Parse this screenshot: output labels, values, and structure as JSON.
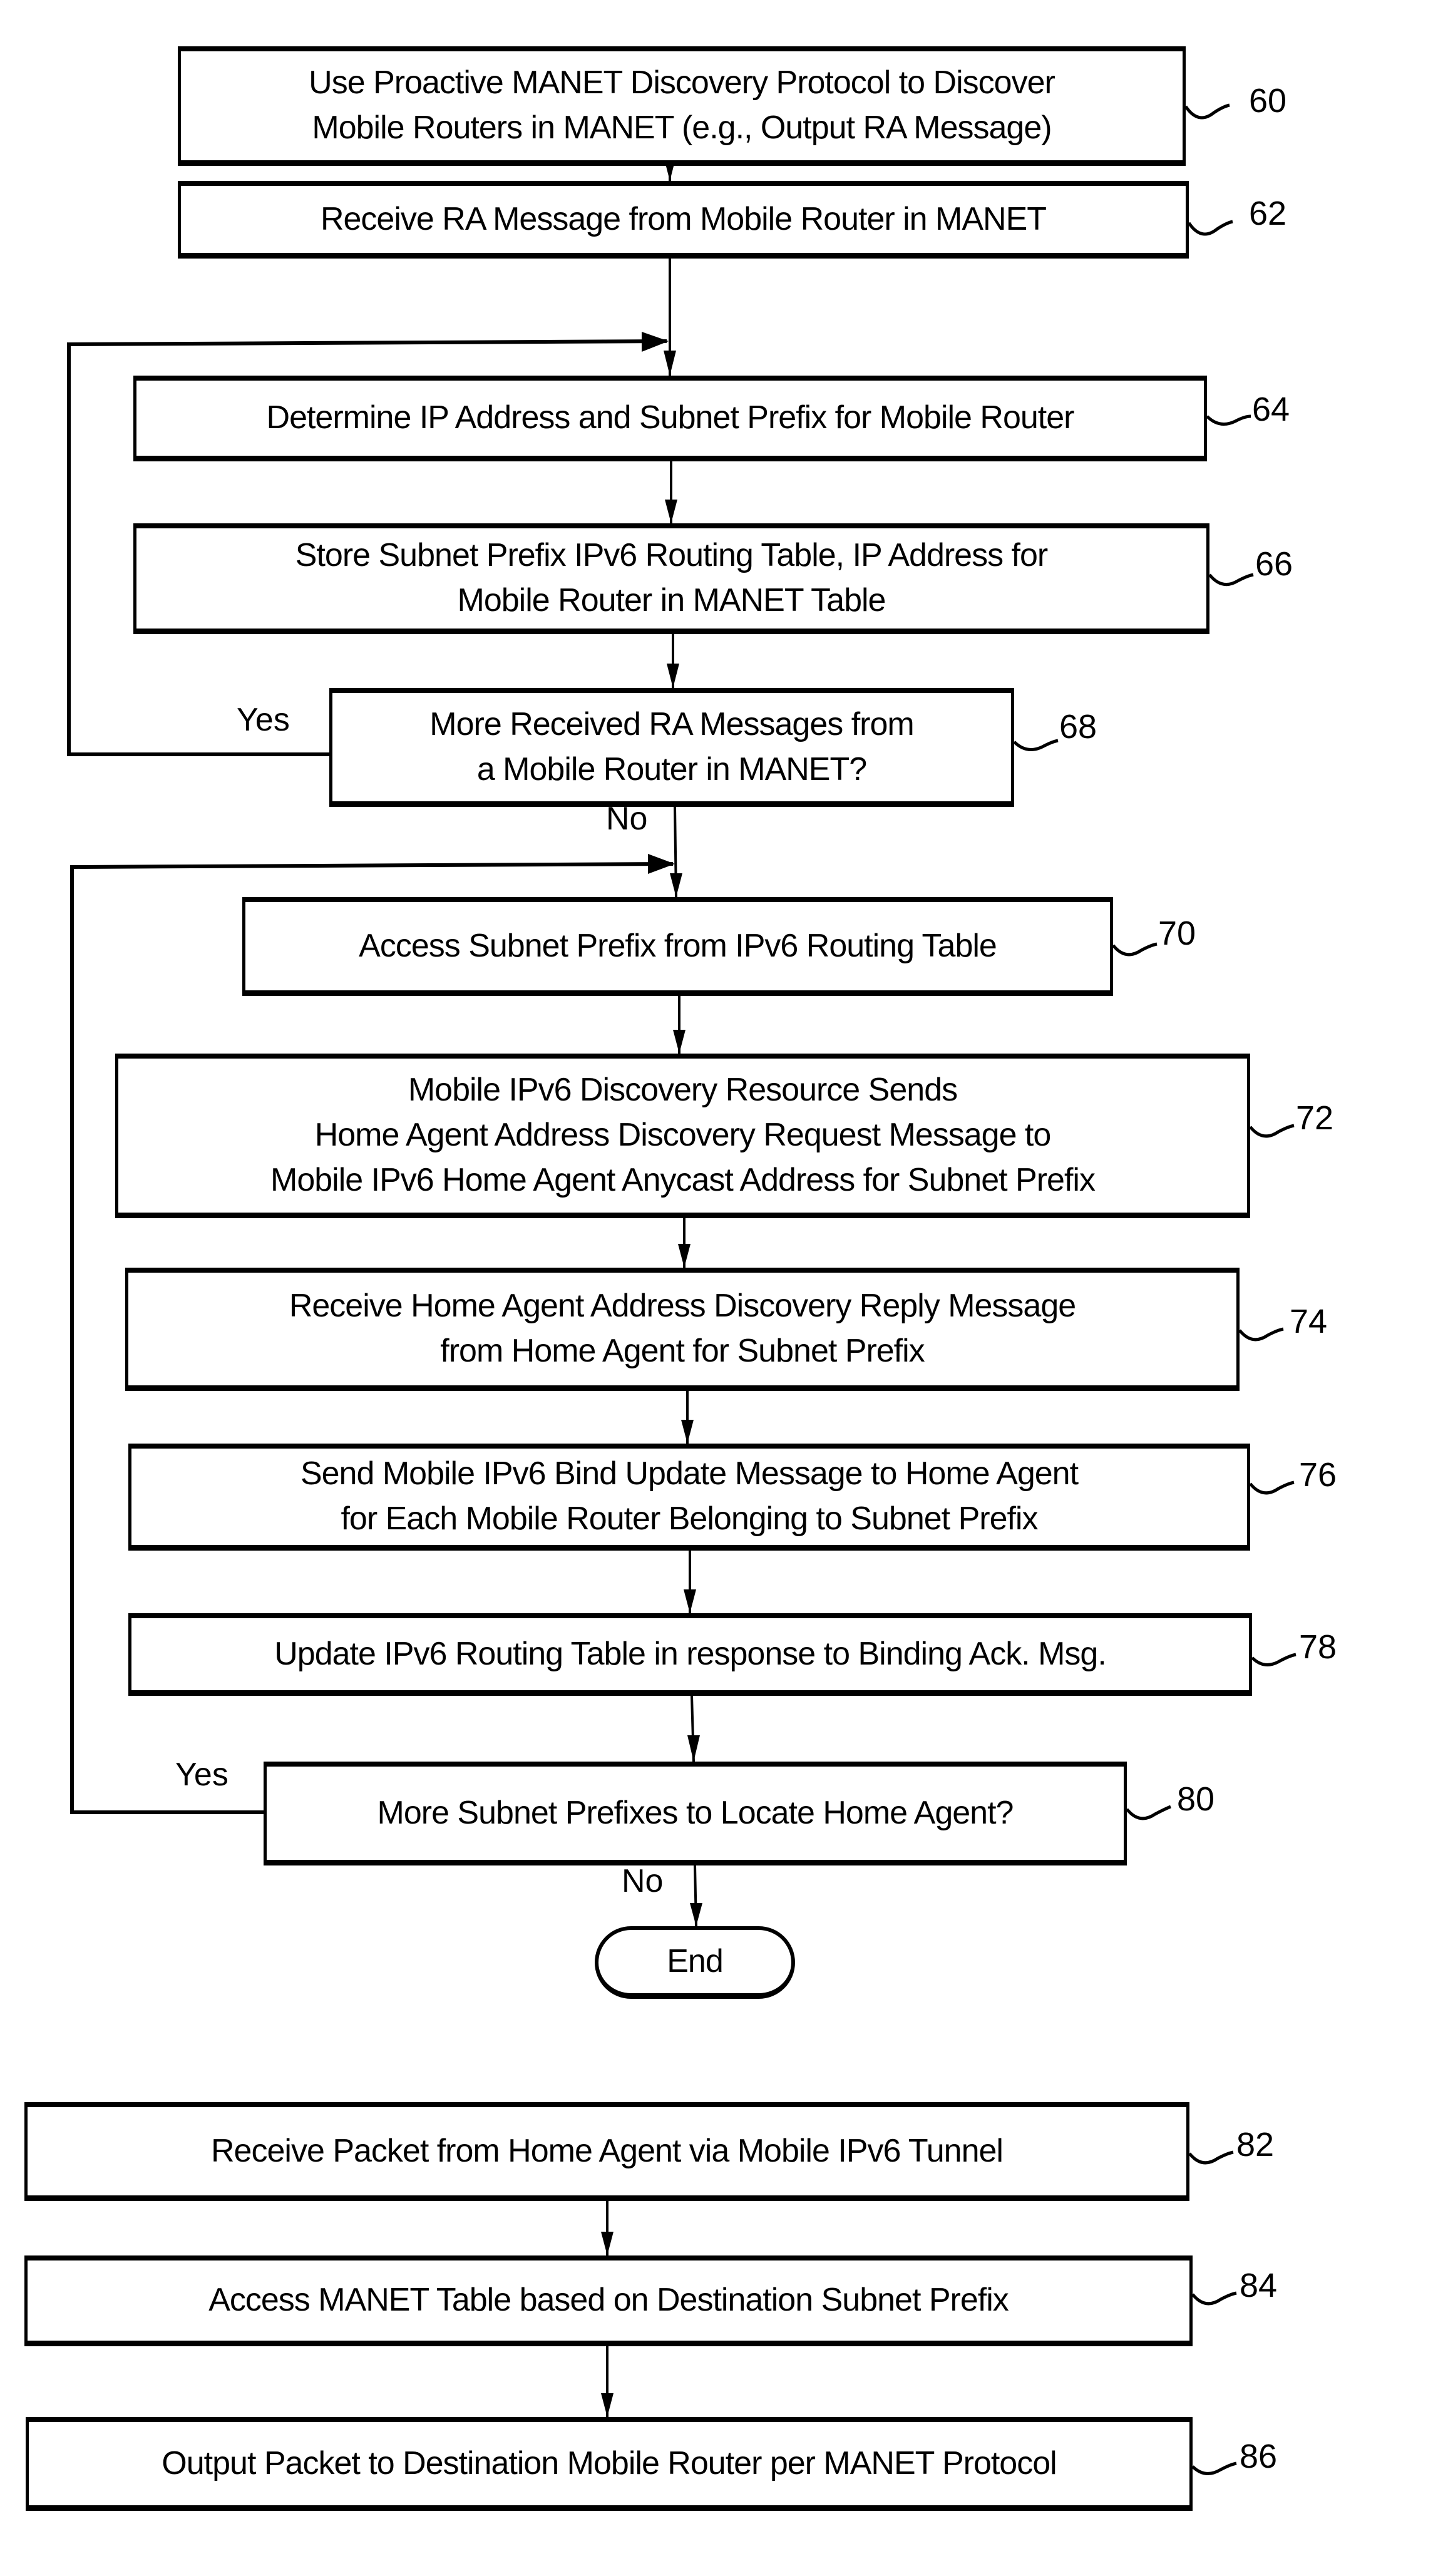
{
  "diagram": {
    "type": "flowchart",
    "steps": [
      {
        "id": "60",
        "lines": [
          "Use Proactive MANET Discovery Protocol to Discover",
          "Mobile Routers in MANET (e.g., Output RA Message)"
        ]
      },
      {
        "id": "62",
        "lines": [
          "Receive RA Message from Mobile Router in MANET"
        ]
      },
      {
        "id": "64",
        "lines": [
          "Determine IP Address and Subnet Prefix for Mobile Router"
        ]
      },
      {
        "id": "66",
        "lines": [
          "Store Subnet Prefix IPv6 Routing Table, IP Address for",
          "Mobile Router in MANET Table"
        ]
      },
      {
        "id": "68",
        "lines": [
          "More Received RA Messages from",
          "a Mobile Router in MANET?"
        ]
      },
      {
        "id": "70",
        "lines": [
          "Access Subnet Prefix from IPv6 Routing Table"
        ]
      },
      {
        "id": "72",
        "lines": [
          "Mobile IPv6 Discovery Resource Sends",
          "Home Agent Address Discovery Request Message to",
          "Mobile IPv6 Home Agent Anycast Address for Subnet Prefix"
        ]
      },
      {
        "id": "74",
        "lines": [
          "Receive Home Agent Address Discovery Reply Message",
          "from Home Agent for Subnet Prefix"
        ]
      },
      {
        "id": "76",
        "lines": [
          "Send Mobile IPv6 Bind Update Message to Home  Agent",
          "for Each Mobile Router Belonging to Subnet Prefix"
        ]
      },
      {
        "id": "78",
        "lines": [
          "Update IPv6 Routing Table in response to Binding Ack. Msg."
        ]
      },
      {
        "id": "80",
        "lines": [
          "More Subnet Prefixes to Locate Home Agent?"
        ]
      },
      {
        "id": "82",
        "lines": [
          "Receive Packet from Home Agent via Mobile IPv6 Tunnel"
        ]
      },
      {
        "id": "84",
        "lines": [
          "Access MANET Table based on Destination Subnet Prefix"
        ]
      },
      {
        "id": "86",
        "lines": [
          "Output Packet to Destination Mobile Router per MANET Protocol"
        ]
      }
    ],
    "terminal": {
      "label": "End"
    },
    "branch_labels": {
      "d68_yes": "Yes",
      "d68_no": "No",
      "d80_yes": "Yes",
      "d80_no": "No"
    }
  }
}
